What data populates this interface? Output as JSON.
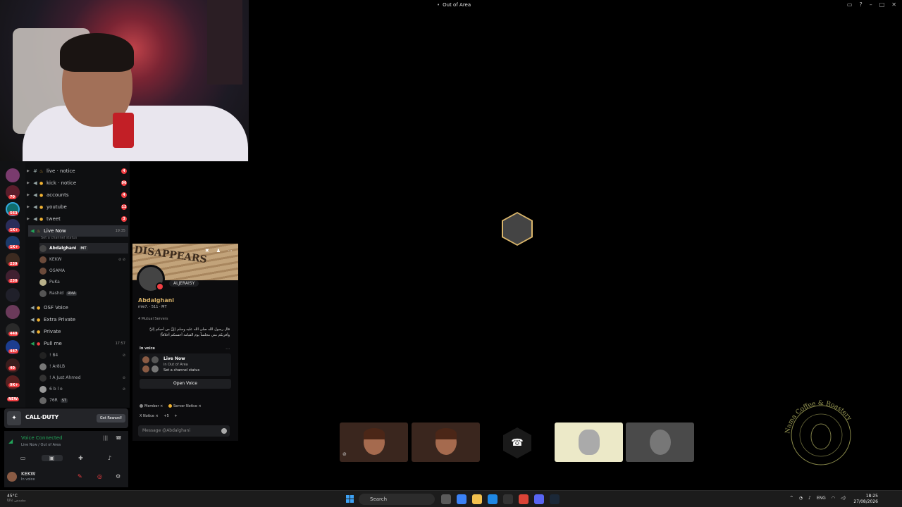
{
  "window": {
    "title": "Out of Area"
  },
  "rail": {
    "badges": [
      "70",
      "1K+",
      "563",
      "1K+",
      "239",
      "448",
      "230",
      "447",
      "40",
      "9K+",
      "NEW"
    ]
  },
  "channels": [
    {
      "name": "live · notice",
      "count": "4",
      "type": "text"
    },
    {
      "name": "kick · notice",
      "count": "96",
      "type": "announce"
    },
    {
      "name": "accounts",
      "count": "4",
      "type": "announce"
    },
    {
      "name": "youtube",
      "count": "12",
      "type": "announce"
    },
    {
      "name": "tweet",
      "count": "3",
      "type": "announce"
    },
    {
      "name": "Live Now",
      "time": "19:35",
      "type": "voice"
    },
    {
      "name": "OSF Voice",
      "type": "voice"
    },
    {
      "name": "Extra Private",
      "type": "voice"
    },
    {
      "name": "Private",
      "type": "voice"
    },
    {
      "name": "Pull me",
      "time": "17:57",
      "type": "voice"
    }
  ],
  "live_now_status": "Set a channel status",
  "voice_users": [
    {
      "name": "Abdalghani",
      "tag": "MT"
    },
    {
      "name": "KEKW",
      "tag": ""
    },
    {
      "name": "OSAMA",
      "tag": ""
    },
    {
      "name": "PuKa",
      "tag": ""
    },
    {
      "name": "Rashid",
      "tag": "RMA"
    }
  ],
  "pull_users": [
    {
      "name": "! B4",
      "tag": ""
    },
    {
      "name": "! Ar8LB",
      "tag": ""
    },
    {
      "name": "! A Just Ahmed",
      "tag": ""
    },
    {
      "name": "6 b l o",
      "tag": ""
    },
    {
      "name": "76R",
      "tag": "ST"
    }
  ],
  "promo": {
    "title": "CALL·DUTY",
    "button": "Get Reward!"
  },
  "voice_panel": {
    "status": "Voice Connected",
    "location": "Live Now / Out of Area"
  },
  "current_user": {
    "name": "KEKW",
    "status": "In voice"
  },
  "profile": {
    "banner_text": "DISAPPEARS",
    "nickname": "ALJERAISY",
    "display_name": "Abdalghani",
    "handle": "mle7. · 511 · MT",
    "mutual": "4 Mutual Servers",
    "bio": "قال رسول الله صلى الله عليه وسلم (إنَّ من أحبكم إليَّ وأقربكم مني مجلساً يوم القيامة أحسنكم أخلاقاً)",
    "in_voice_label": "In voice",
    "voice_channel": "Live Now",
    "voice_server": "in Out of Area",
    "voice_status": "Set a channel status",
    "open_voice": "Open Voice",
    "roles": [
      "Member",
      "Server Notice",
      "X Notice",
      "+5"
    ]
  },
  "message_placeholder": "Message @Abdalghani",
  "watermark": {
    "text": "Nama Coffee & Roastery"
  },
  "taskbar": {
    "weather_temp": "45°C",
    "weather_desc": "مشمس غالبًا",
    "search": "Search",
    "lang": "ENG",
    "time": "18:25",
    "date": "27/08/2026"
  },
  "colors": {
    "accent_green": "#23a55a",
    "badge_red": "#f23f43",
    "gold": "#d9b56a"
  }
}
